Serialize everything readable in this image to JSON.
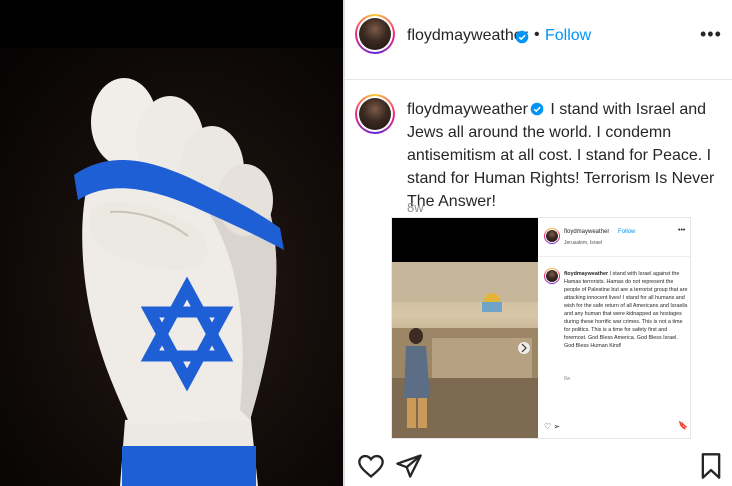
{
  "post": {
    "username": "floydmayweather",
    "follow_label": "Follow",
    "dot": "•",
    "more_label": "•••"
  },
  "caption": {
    "username": "floydmayweather",
    "text": "I stand with Israel and Jews all around the world. I condemn antisemitism at all cost. I stand for Peace. I stand for Human Rights! Terrorism Is Never The Answer!",
    "time": "8w"
  },
  "embedded_post": {
    "username": "floydmayweather",
    "follow_label": "Follow",
    "location": "Jerusalem, Israel",
    "more_label": "•••",
    "caption": "I stand with Israel against the Hamas terrorists. Hamas do not represent the people of Palestine but are a terrorist group that are attacking innocent lives! I stand for all humans and wish for the safe return of all Americans and Israelis and any human that were kidnapped as hostages during these horrific war crimes. This is not a time for politics. This is a time for safety first and foremost. God Bless America. God Bless Israel. God Bless Human Kind!",
    "time": "8w"
  },
  "colors": {
    "link": "#0095f6",
    "verified": "#0095f6",
    "flag_blue": "#1f5fd6",
    "text": "#262626",
    "muted": "#8e8e8e"
  },
  "icons": {
    "like": "heart-icon",
    "share": "send-icon",
    "save": "bookmark-icon"
  }
}
